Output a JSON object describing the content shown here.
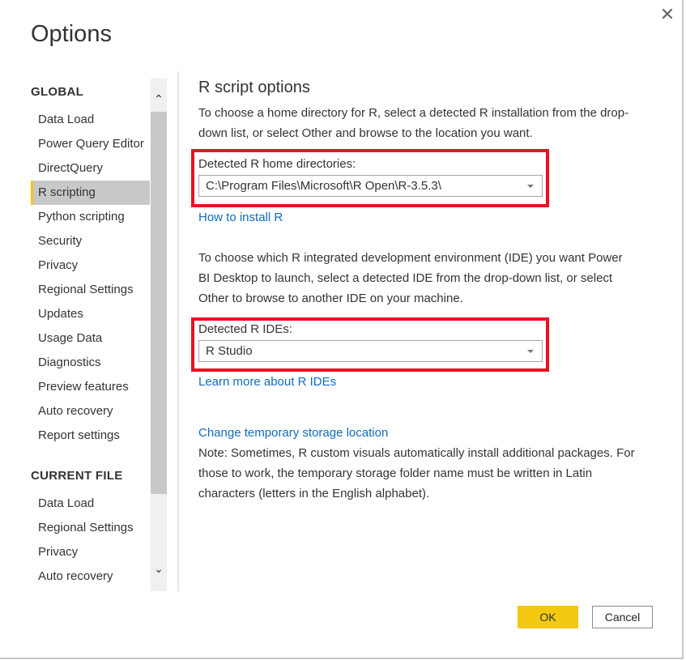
{
  "dialog": {
    "title": "Options",
    "close_icon": "close-icon"
  },
  "sidebar": {
    "global_header": "GLOBAL",
    "global_items": [
      {
        "label": "Data Load"
      },
      {
        "label": "Power Query Editor"
      },
      {
        "label": "DirectQuery"
      },
      {
        "label": "R scripting",
        "selected": true
      },
      {
        "label": "Python scripting"
      },
      {
        "label": "Security"
      },
      {
        "label": "Privacy"
      },
      {
        "label": "Regional Settings"
      },
      {
        "label": "Updates"
      },
      {
        "label": "Usage Data"
      },
      {
        "label": "Diagnostics"
      },
      {
        "label": "Preview features"
      },
      {
        "label": "Auto recovery"
      },
      {
        "label": "Report settings"
      }
    ],
    "current_header": "CURRENT FILE",
    "current_items": [
      {
        "label": "Data Load"
      },
      {
        "label": "Regional Settings"
      },
      {
        "label": "Privacy"
      },
      {
        "label": "Auto recovery"
      }
    ]
  },
  "main": {
    "heading": "R script options",
    "intro": "To choose a home directory for R, select a detected R installation from the drop-down list, or select Other and browse to the location you want.",
    "home_label": "Detected R home directories:",
    "home_value": "C:\\Program Files\\Microsoft\\R Open\\R-3.5.3\\",
    "install_link": "How to install R",
    "ide_intro": "To choose which R integrated development environment (IDE) you want Power BI Desktop to launch, select a detected IDE from the drop-down list, or select Other to browse to another IDE on your machine.",
    "ide_label": "Detected R IDEs:",
    "ide_value": "R Studio",
    "ide_link": "Learn more about R IDEs",
    "storage_link": "Change temporary storage location",
    "note": "Note: Sometimes, R custom visuals automatically install additional packages. For those to work, the temporary storage folder name must be written in Latin characters (letters in the English alphabet)."
  },
  "footer": {
    "ok": "OK",
    "cancel": "Cancel"
  },
  "colors": {
    "accent": "#f2c811",
    "highlight_box": "#e81123",
    "link": "#0f6cbd"
  }
}
